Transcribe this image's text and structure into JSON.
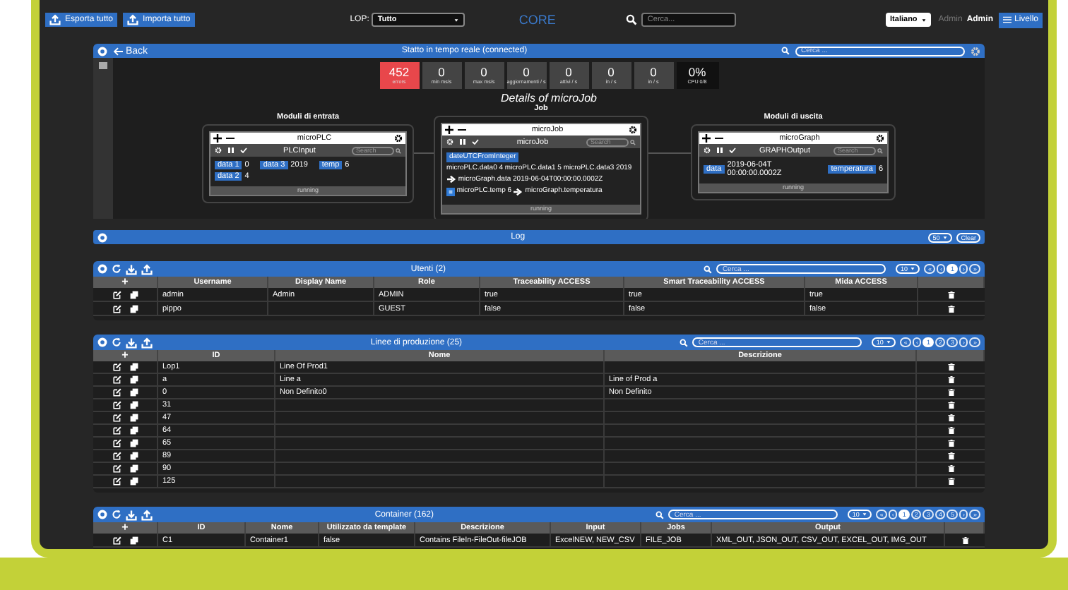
{
  "top_bar": {
    "buttons": [
      {
        "label": "Esporta tutto"
      },
      {
        "label": "Importa tutto"
      }
    ],
    "lop": {
      "label": "LOP:",
      "value": "Tutto"
    },
    "brand": "CORE",
    "search": {
      "placeholder": "Cerca..."
    },
    "language": "Italiano",
    "user": {
      "role": "Admin",
      "name": "Admin"
    },
    "menu_button": "Livello"
  },
  "realtime": {
    "back": "Back",
    "title": "Statto in tempo reale (connected)",
    "search": {
      "placeholder": "Cerca ..."
    },
    "stats": [
      {
        "value": "452",
        "label": "errors",
        "kind": "error"
      },
      {
        "value": "0",
        "label": "min ms/s",
        "kind": "normal"
      },
      {
        "value": "0",
        "label": "max ms/s",
        "kind": "normal"
      },
      {
        "value": "0",
        "label": "aggiornamenti / s",
        "kind": "normal"
      },
      {
        "value": "0",
        "label": "attivi / s",
        "kind": "normal"
      },
      {
        "value": "0",
        "label": "in / s",
        "kind": "normal"
      },
      {
        "value": "0",
        "label": "in / s",
        "kind": "normal"
      },
      {
        "value": "0%",
        "label": "CPU 0/8",
        "kind": "cpu"
      }
    ],
    "details_title": "Details of microJob",
    "job_title": "Job",
    "inputs_title": "Moduli di entrata",
    "outputs_title": "Moduli di uscita",
    "modules": [
      {
        "kind": "input",
        "title": "microPLC",
        "subtitle": "PLCInput",
        "search": {
          "placeholder": "Search"
        },
        "fields": [
          {
            "tag": "data 1",
            "value": "0"
          },
          {
            "tag": "data 3",
            "value": "2019"
          },
          {
            "tag": "temp",
            "value": "6"
          },
          {
            "tag": "data 2",
            "value": "4"
          }
        ],
        "status": "running"
      },
      {
        "kind": "job",
        "title": "microJob",
        "subtitle": "microJob",
        "search": {
          "placeholder": "Search"
        },
        "mappings": [
          {
            "kind": "function",
            "tag": "dateUTCFromInteger",
            "source": "microPLC.data0 4 microPLC.data1 5 microPLC.data3 2019",
            "target": "microGraph.data 2019-06-04T00:00:00.0002Z"
          },
          {
            "kind": "direct",
            "source": "microPLC.temp 6",
            "target": "microGraph.temperatura"
          }
        ],
        "status": "running"
      },
      {
        "kind": "output",
        "title": "microGraph",
        "subtitle": "GRAPHOutput",
        "search": {
          "placeholder": "Search"
        },
        "fields": [
          {
            "tag": "data",
            "value": "2019-06-04T 00:00:00.0002Z"
          },
          {
            "tag": "temperatura",
            "value": "6"
          }
        ],
        "status": "running"
      }
    ]
  },
  "log": {
    "title": "Log",
    "page_size": "50",
    "clear": "Clear"
  },
  "tables": [
    {
      "title": "Utenti (2)",
      "search": {
        "placeholder": "Cerca ..."
      },
      "page_size": "10",
      "pages": [
        {
          "label": "«",
          "selected": false
        },
        {
          "label": "‹",
          "selected": false
        },
        {
          "label": "1",
          "selected": true
        },
        {
          "label": "›",
          "selected": false
        },
        {
          "label": "»",
          "selected": false
        }
      ],
      "add": "+",
      "columns": [
        "Username",
        "Display Name",
        "Role",
        "Traceability ACCESS",
        "Smart Traceability ACCESS",
        "Mida ACCESS"
      ],
      "rows": [
        [
          "admin",
          "Admin",
          "ADMIN",
          "true",
          "true",
          "true"
        ],
        [
          "pippo",
          null,
          "GUEST",
          "false",
          "false",
          "false"
        ]
      ]
    },
    {
      "title": "Linee di produzione (25)",
      "search": {
        "placeholder": "Cerca ..."
      },
      "page_size": "10",
      "pages": [
        {
          "label": "«",
          "selected": false
        },
        {
          "label": "‹",
          "selected": false
        },
        {
          "label": "1",
          "selected": true
        },
        {
          "label": "2",
          "selected": false
        },
        {
          "label": "3",
          "selected": false
        },
        {
          "label": "›",
          "selected": false
        },
        {
          "label": "»",
          "selected": false
        }
      ],
      "add": "+",
      "columns": [
        "ID",
        "Nome",
        "Descrizione"
      ],
      "rows": [
        [
          "Lop1",
          "Line Of Prod1",
          null
        ],
        [
          "a",
          "Line a",
          "Line of Prod a"
        ],
        [
          "0",
          "Non Definito0",
          "Non Definito"
        ],
        [
          "31",
          null,
          null
        ],
        [
          "47",
          null,
          null
        ],
        [
          "64",
          null,
          null
        ],
        [
          "65",
          null,
          null
        ],
        [
          "89",
          null,
          null
        ],
        [
          "90",
          null,
          null
        ],
        [
          "125",
          null,
          null
        ]
      ]
    },
    {
      "title": "Container (162)",
      "search": {
        "placeholder": "Cerca ..."
      },
      "page_size": "10",
      "pages": [
        {
          "label": "«",
          "selected": false
        },
        {
          "label": "‹",
          "selected": false
        },
        {
          "label": "1",
          "selected": true
        },
        {
          "label": "2",
          "selected": false
        },
        {
          "label": "3",
          "selected": false
        },
        {
          "label": "4",
          "selected": false
        },
        {
          "label": "5",
          "selected": false
        },
        {
          "label": "›",
          "selected": false
        },
        {
          "label": "»",
          "selected": false
        }
      ],
      "add": "+",
      "columns": [
        "ID",
        "Nome",
        "Utilizzato da template",
        "Descrizione",
        "Input",
        "Jobs",
        "Output"
      ],
      "rows": [
        [
          "C1",
          "Container1",
          "false",
          "Contains FileIn-FileOut-fileJOB",
          "ExcelNEW, NEW_CSV",
          "FILE_JOB",
          "XML_OUT, JSON_OUT, CSV_OUT, EXCEL_OUT, IMG_OUT"
        ]
      ]
    }
  ]
}
